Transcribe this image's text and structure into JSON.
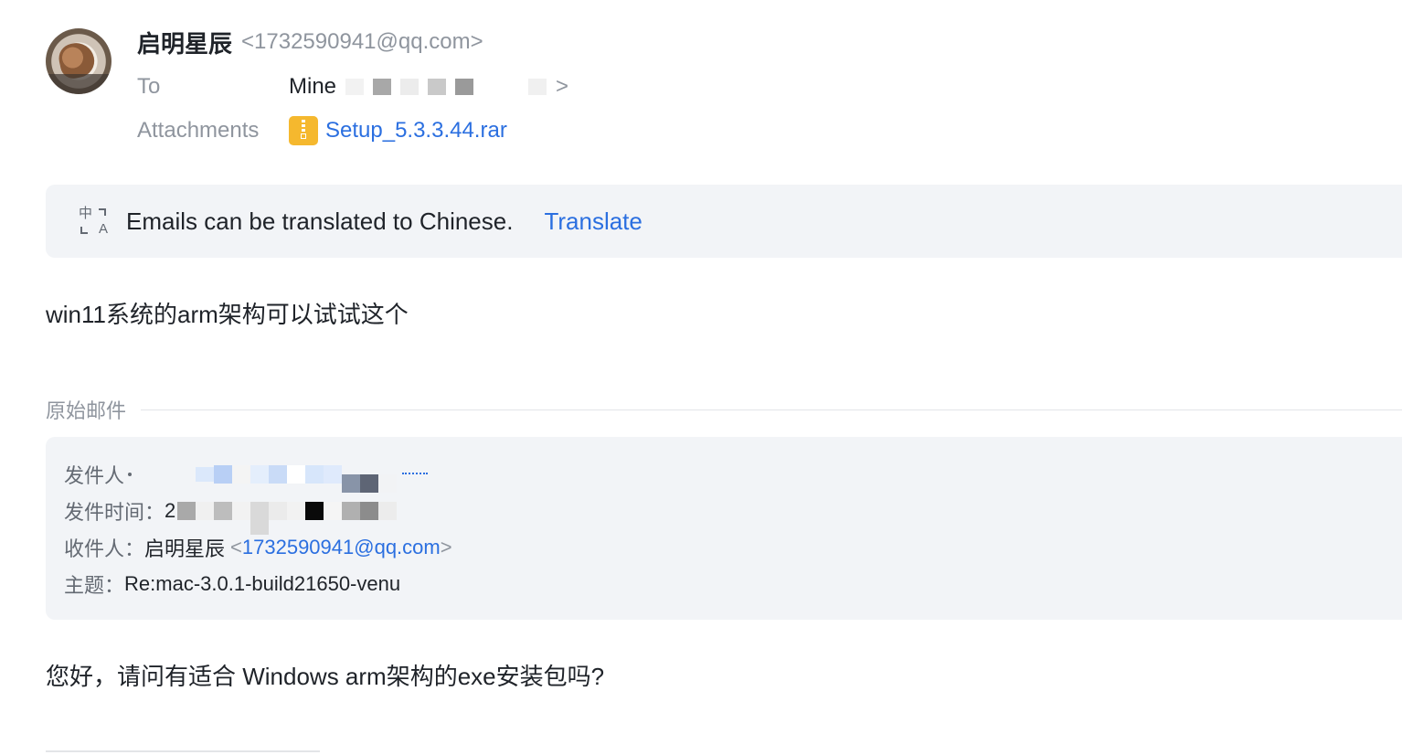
{
  "header": {
    "sender_name": "启明星辰",
    "sender_email": "<1732590941@qq.com>",
    "to_label": "To",
    "to_value": "Mine",
    "to_close": ">",
    "attachments_label": "Attachments",
    "attachment_name": "Setup_5.3.3.44.rar"
  },
  "translate_banner": {
    "icon_top": "中",
    "icon_bottom": "A",
    "message": "Emails can be translated to Chinese.",
    "action": "Translate"
  },
  "body": {
    "text": "win11系统的arm架构可以试试这个"
  },
  "original_mail": {
    "label": "原始邮件",
    "from_label": "发件人",
    "from_tail": "",
    "time_label": "发件时间：",
    "time_head": "2",
    "time_tail": "",
    "to_label": "收件人：",
    "to_name": "启明星辰",
    "to_email_open": "<",
    "to_email": "1732590941@qq.com",
    "to_email_close": ">",
    "subject_label": "主题：",
    "subject": "Re:mac-3.0.1-build21650-venu"
  },
  "reply": {
    "text": "您好，请问有适合 Windows arm架构的exe安装包吗?"
  },
  "colors": {
    "link": "#2b6fe0",
    "muted": "#8f959e",
    "panel": "#f2f4f7",
    "attachment_icon": "#f5b82e"
  },
  "icons": {
    "avatar": "avatar-photo",
    "attachment": "zip-file-icon",
    "translate": "translate-icon"
  }
}
